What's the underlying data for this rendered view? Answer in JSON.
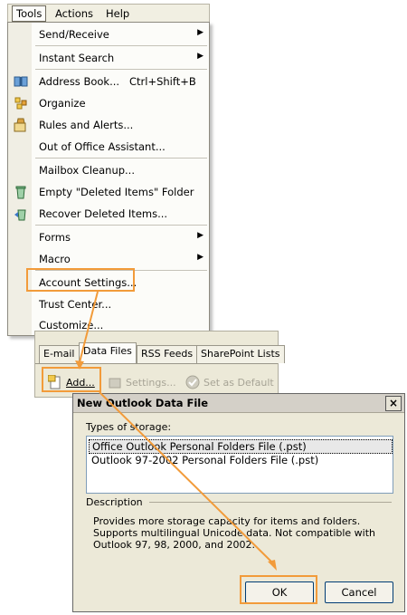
{
  "menubar": {
    "items": [
      "Tools",
      "Actions",
      "Help"
    ]
  },
  "tools_menu": {
    "send_receive": "Send/Receive",
    "instant_search": "Instant Search",
    "address_book": "Address Book...",
    "address_book_shortcut": "Ctrl+Shift+B",
    "organize": "Organize",
    "rules_alerts": "Rules and Alerts...",
    "out_of_office": "Out of Office Assistant...",
    "mailbox_cleanup": "Mailbox Cleanup...",
    "empty_deleted": "Empty \"Deleted Items\" Folder",
    "recover_deleted": "Recover Deleted Items...",
    "forms": "Forms",
    "macro": "Macro",
    "account_settings": "Account Settings...",
    "trust_center": "Trust Center...",
    "customize": "Customize..."
  },
  "account_tabs": [
    "E-mail",
    "Data Files",
    "RSS Feeds",
    "SharePoint Lists"
  ],
  "toolbar": {
    "add": "Add...",
    "settings": "Settings...",
    "set_default": "Set as Default"
  },
  "dialog": {
    "title": "New Outlook Data File",
    "close": "×",
    "types_label": "Types of storage:",
    "storage_types": [
      "Office Outlook Personal Folders File (.pst)",
      "Outlook 97-2002 Personal Folders File (.pst)"
    ],
    "description_label": "Description",
    "description_lines": [
      "Provides more storage capacity for items and folders.",
      "Supports multilingual Unicode data. Not compatible with",
      "Outlook 97, 98, 2000, and 2002."
    ],
    "ok": "OK",
    "cancel": "Cancel"
  },
  "colors": {
    "highlight": "#f29b3a",
    "menu_bg": "#fcfcf9",
    "dialog_bg": "#ece9d8"
  }
}
